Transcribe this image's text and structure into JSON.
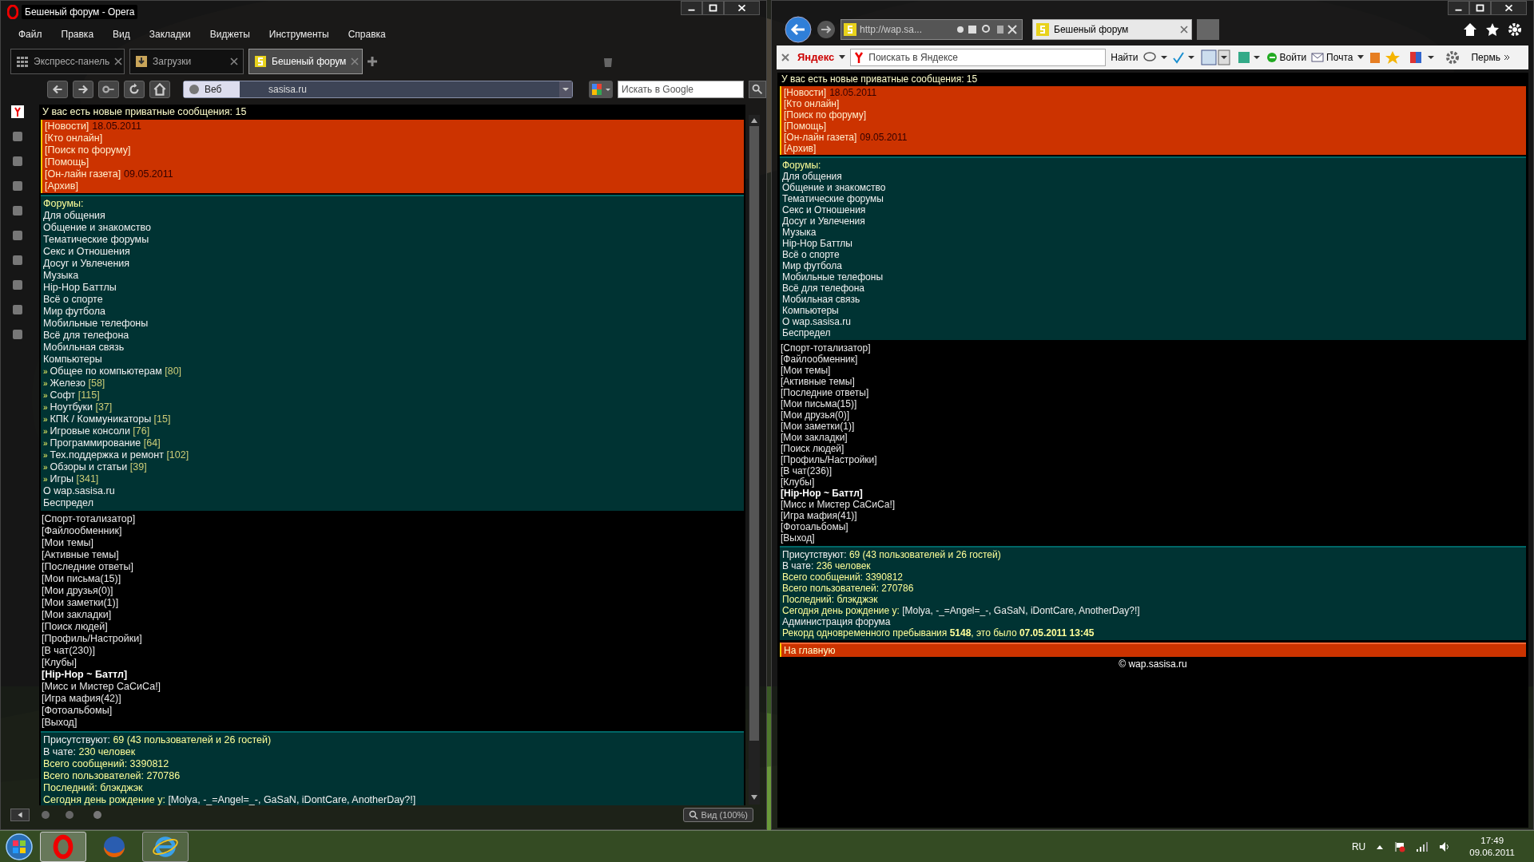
{
  "opera": {
    "title": "Бешеный форум - Opera",
    "menu": [
      "Файл",
      "Правка",
      "Вид",
      "Закладки",
      "Виджеты",
      "Инструменты",
      "Справка"
    ],
    "tabs": [
      {
        "label": "Экспресс-панель",
        "selected": false
      },
      {
        "label": "Загрузки",
        "selected": false
      },
      {
        "label": "Бешеный форум",
        "selected": true
      }
    ],
    "address": {
      "scope": "Веб",
      "url": "sasisa.ru"
    },
    "search": {
      "placeholder": "Искать в Google"
    },
    "zoom": "Вид (100%)",
    "page": {
      "notice": "У вас есть новые приватные сообщения: 15",
      "news": [
        {
          "label": "[Новости]",
          "date": "18.05.2011"
        },
        {
          "label": "[Кто онлайн]"
        },
        {
          "label": "[Поиск по форуму]"
        },
        {
          "label": "[Помощь]"
        },
        {
          "label": "[Он-лайн газета]",
          "date": "09.05.2011"
        },
        {
          "label": "[Архив]"
        }
      ],
      "forums_heading": "Форумы:",
      "forums": [
        {
          "label": "Для общения"
        },
        {
          "label": "Общение и знакомство"
        },
        {
          "label": "Тематические форумы"
        },
        {
          "label": "Секс и Отношения"
        },
        {
          "label": "Досуг и Увлечения"
        },
        {
          "label": "Музыка"
        },
        {
          "label": "Hip-Hop Баттлы"
        },
        {
          "label": "Всё о спорте"
        },
        {
          "label": "Мир футбола"
        },
        {
          "label": "Мобильные телефоны"
        },
        {
          "label": "Всё для телефона"
        },
        {
          "label": "Мобильная связь"
        },
        {
          "label": "Компьютеры",
          "children": [
            {
              "bullet": "»",
              "label": "Общее по компьютерам",
              "count": "[80]"
            },
            {
              "bullet": "»",
              "label": "Железо",
              "count": "[58]"
            },
            {
              "bullet": "»",
              "label": "Софт",
              "count": "[115]"
            },
            {
              "bullet": "»",
              "label": "Ноутбуки",
              "count": "[37]"
            },
            {
              "bullet": "»",
              "label": "КПК / Коммуникаторы",
              "count": "[15]"
            },
            {
              "bullet": "»",
              "label": "Игровые консоли",
              "count": "[76]"
            },
            {
              "bullet": "»",
              "label": "Программирование",
              "count": "[64]"
            },
            {
              "bullet": "»",
              "label": "Тех.поддержка и ремонт",
              "count": "[102]"
            },
            {
              "bullet": "»",
              "label": "Обзоры и статьи",
              "count": "[39]"
            },
            {
              "bullet": "»",
              "label": "Игры",
              "count": "[341]"
            }
          ]
        },
        {
          "label": "О wap.sasisa.ru"
        },
        {
          "label": "Беспредел"
        }
      ],
      "links": [
        {
          "label": "[Спорт-тотализатор]",
          "bold": false
        },
        {
          "label": "[Файлообменник]",
          "bold": false
        },
        {
          "label": "[Мои темы]",
          "bold": false
        },
        {
          "label": "[Активные темы]",
          "bold": false
        },
        {
          "label": "[Последние ответы]",
          "bold": false
        },
        {
          "label": "[Мои письма(15)]",
          "bold": false
        },
        {
          "label": "[Мои друзья(0)]",
          "bold": false
        },
        {
          "label": "[Мои заметки(1)]",
          "bold": false
        },
        {
          "label": "[Мои закладки]",
          "bold": false
        },
        {
          "label": "[Поиск людей]",
          "bold": false
        },
        {
          "label": "[Профиль/Настройки]",
          "bold": false
        },
        {
          "label": "[В чат(230)]",
          "bold": false
        },
        {
          "label": "[Клубы]",
          "bold": false
        },
        {
          "label": "[Hip-Hop ~ Баттл]",
          "bold": true
        },
        {
          "label": "[Мисс и Мистер СаСиСа!]",
          "bold": false
        },
        {
          "label": "[Игра мафия(42)]",
          "bold": false
        },
        {
          "label": "[Фотоальбомы]",
          "bold": false
        },
        {
          "label": "[Выход]",
          "bold": false
        }
      ],
      "stats": [
        {
          "kind": "pair",
          "label": "Присутствуют:",
          "value": "69 (43 пользователей и 26 гостей)"
        },
        {
          "kind": "pair",
          "label": "В чате:",
          "value": "230 человек"
        },
        {
          "kind": "accent",
          "text": "Всего сообщений: 3390812"
        },
        {
          "kind": "accent",
          "text": "Всего пользователей: 270786"
        },
        {
          "kind": "accent",
          "text": "Последний: блэкджэк"
        },
        {
          "kind": "pair_inv",
          "label": "Сегодня день рождение у:",
          "value": "[Molya, -_=Angel=_-, GaSaN, iDontCare, AnotherDay?!]"
        }
      ]
    }
  },
  "ie": {
    "address": "http://wap.sa...",
    "tab": "Бешеный форум",
    "toolbar": {
      "brand": "Яндекс",
      "placeholder": "Поискать в Яндексе",
      "find": "Найти",
      "login": "Войти",
      "mail": "Почта",
      "city": "Пермь"
    },
    "page": {
      "notice": "У вас есть новые приватные сообщения: 15",
      "news": [
        {
          "label": "[Новости]",
          "date": "18.05.2011"
        },
        {
          "label": "[Кто онлайн]"
        },
        {
          "label": "[Поиск по форуму]"
        },
        {
          "label": "[Помощь]"
        },
        {
          "label": "[Он-лайн газета]",
          "date": "09.05.2011"
        },
        {
          "label": "[Архив]"
        }
      ],
      "forums_heading": "Форумы:",
      "forums": [
        {
          "label": "Для общения"
        },
        {
          "label": "Общение и знакомство"
        },
        {
          "label": "Тематические форумы"
        },
        {
          "label": "Секс и Отношения"
        },
        {
          "label": "Досуг и Увлечения"
        },
        {
          "label": "Музыка"
        },
        {
          "label": "Hip-Hop Баттлы"
        },
        {
          "label": "Всё о спорте"
        },
        {
          "label": "Мир футбола"
        },
        {
          "label": "Мобильные телефоны"
        },
        {
          "label": "Всё для телефона"
        },
        {
          "label": "Мобильная связь"
        },
        {
          "label": "Компьютеры"
        },
        {
          "label": "О wap.sasisa.ru"
        },
        {
          "label": "Беспредел"
        }
      ],
      "links": [
        {
          "label": "[Спорт-тотализатор]",
          "bold": false
        },
        {
          "label": "[Файлообменник]",
          "bold": false
        },
        {
          "label": "[Мои темы]",
          "bold": false
        },
        {
          "label": "[Активные темы]",
          "bold": false
        },
        {
          "label": "[Последние ответы]",
          "bold": false
        },
        {
          "label": "[Мои письма(15)]",
          "bold": false
        },
        {
          "label": "[Мои друзья(0)]",
          "bold": false
        },
        {
          "label": "[Мои заметки(1)]",
          "bold": false
        },
        {
          "label": "[Мои закладки]",
          "bold": false
        },
        {
          "label": "[Поиск людей]",
          "bold": false
        },
        {
          "label": "[Профиль/Настройки]",
          "bold": false
        },
        {
          "label": "[В чат(236)]",
          "bold": false
        },
        {
          "label": "[Клубы]",
          "bold": false
        },
        {
          "label": "[Hip-Hop ~ Баттл]",
          "bold": true
        },
        {
          "label": "[Мисс и Мистер СаСиСа!]",
          "bold": false
        },
        {
          "label": "[Игра мафия(41)]",
          "bold": false
        },
        {
          "label": "[Фотоальбомы]",
          "bold": false
        },
        {
          "label": "[Выход]",
          "bold": false
        }
      ],
      "stats": [
        {
          "kind": "pair",
          "label": "Присутствуют:",
          "value": "69 (43 пользователей и 26 гостей)"
        },
        {
          "kind": "pair",
          "label": "В чате:",
          "value": "236 человек"
        },
        {
          "kind": "accent",
          "text": "Всего сообщений: 3390812"
        },
        {
          "kind": "accent",
          "text": "Всего пользователей: 270786"
        },
        {
          "kind": "accent",
          "text": "Последний: блэкджэк"
        },
        {
          "kind": "pair_inv",
          "label": "Сегодня день рождение у:",
          "value": "[Molya, -_=Angel=_-, GaSaN, iDontCare, AnotherDay?!]"
        },
        {
          "kind": "plain",
          "text": "Администрация форума"
        },
        {
          "kind": "accent",
          "text": "Рекорд одновременного пребывания **5148**, это было **07.05.2011 13:45**"
        }
      ],
      "home": "На главную",
      "copyright": "© wap.sasisa.ru"
    }
  },
  "taskbar": {
    "language": "RU",
    "time": "17:49",
    "date": "09.06.2011"
  }
}
